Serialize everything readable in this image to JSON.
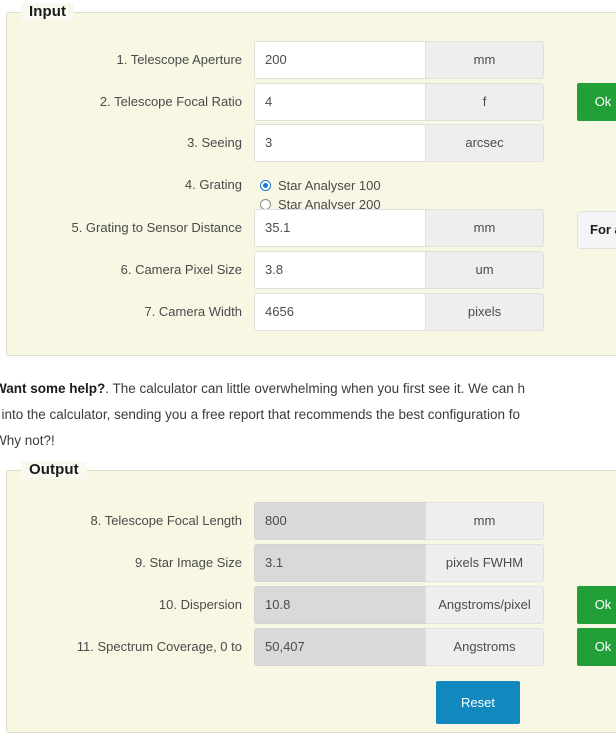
{
  "input_section": {
    "legend": "Input",
    "rows": [
      {
        "label": "1. Telescope Aperture",
        "value": "200",
        "unit": "mm",
        "status": ""
      },
      {
        "label": "2. Telescope Focal Ratio",
        "value": "4",
        "unit": "f",
        "status": "Ok"
      },
      {
        "label": "3. Seeing",
        "value": "3",
        "unit": "arcsec",
        "status": ""
      },
      {
        "label": "5. Grating to Sensor Distance",
        "value": "35.1",
        "unit": "mm",
        "status": ""
      },
      {
        "label": "6. Camera Pixel Size",
        "value": "3.8",
        "unit": "um",
        "status": ""
      },
      {
        "label": "7. Camera Width",
        "value": "4656",
        "unit": "pixels",
        "status": ""
      }
    ],
    "grating": {
      "label": "4. Grating",
      "options": [
        {
          "label": "Star Analyser 100",
          "selected": true
        },
        {
          "label": "Star Analyser 200",
          "selected": false
        }
      ]
    },
    "note": "For a"
  },
  "help": {
    "lead": "Want some help?",
    "line1_rest": ". The calculator can little overwhelming when you first see it. We can h",
    "line2": "t into the calculator, sending you a free report that recommends the best configuration fo",
    "line3": "Why not?!"
  },
  "output_section": {
    "legend": "Output",
    "rows": [
      {
        "label": "8. Telescope Focal Length",
        "value": "800",
        "unit": "mm",
        "status": ""
      },
      {
        "label": "9. Star Image Size",
        "value": "3.1",
        "unit": "pixels FWHM",
        "status": ""
      },
      {
        "label": "10. Dispersion",
        "value": "10.8",
        "unit": "Angstroms/pixel",
        "status": "Ok"
      },
      {
        "label": "11. Spectrum Coverage, 0 to",
        "value": "50,407",
        "unit": "Angstroms",
        "status": "Ok"
      }
    ]
  },
  "reset_button": {
    "label": "Reset"
  },
  "colors": {
    "page_background": "#f7f7e4",
    "ok_badge": "#21a038",
    "reset_button": "#1189bf",
    "radio_accent": "#1576d4",
    "readonly_field": "#d9d9d9"
  }
}
